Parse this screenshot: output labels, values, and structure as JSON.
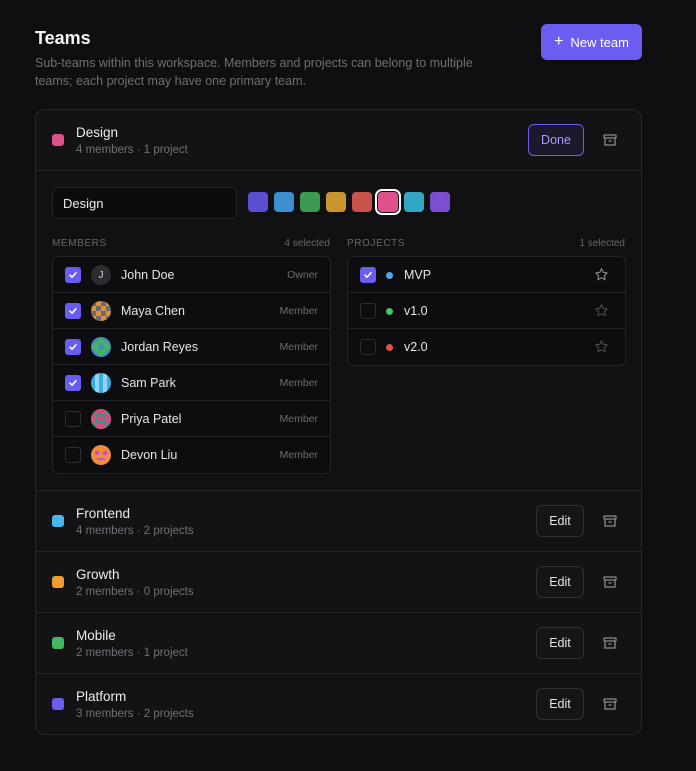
{
  "header": {
    "title": "Teams",
    "subtitle": "Sub-teams within this workspace. Members and projects can belong to multiple teams; each project may have one primary team.",
    "new_team_label": "New team"
  },
  "editing_team": {
    "name": "Design",
    "meta": "4 members · 1 project",
    "color": "#e0508c",
    "done_label": "Done",
    "name_input_value": "Design",
    "swatches": [
      "#5b4fd1",
      "#3d8fcf",
      "#3b9a4f",
      "#c8952f",
      "#c9524c",
      "#e0508c",
      "#33a7c2",
      "#7c4fd1"
    ],
    "selected_swatch": 5,
    "members_label": "MEMBERS",
    "members_count": "4 selected",
    "projects_label": "PROJECTS",
    "projects_count": "1 selected",
    "members": [
      {
        "name": "John Doe",
        "role": "Owner",
        "checked": true,
        "initial": "J"
      },
      {
        "name": "Maya Chen",
        "role": "Member",
        "checked": true
      },
      {
        "name": "Jordan Reyes",
        "role": "Member",
        "checked": true
      },
      {
        "name": "Sam Park",
        "role": "Member",
        "checked": true
      },
      {
        "name": "Priya Patel",
        "role": "Member",
        "checked": false
      },
      {
        "name": "Devon Liu",
        "role": "Member",
        "checked": false
      }
    ],
    "projects": [
      {
        "name": "MVP",
        "color": "#4aa8f0",
        "checked": true
      },
      {
        "name": "v1.0",
        "color": "#4cc06a",
        "checked": false
      },
      {
        "name": "v2.0",
        "color": "#e0514b",
        "checked": false
      }
    ]
  },
  "teams": [
    {
      "name": "Frontend",
      "meta": "4 members · 2 projects",
      "color": "#4ab6f0",
      "edit_label": "Edit"
    },
    {
      "name": "Growth",
      "meta": "2 members · 0 projects",
      "color": "#f09a32",
      "edit_label": "Edit"
    },
    {
      "name": "Mobile",
      "meta": "2 members · 1 project",
      "color": "#43b85e",
      "edit_label": "Edit"
    },
    {
      "name": "Platform",
      "meta": "3 members · 2 projects",
      "color": "#6b5cf2",
      "edit_label": "Edit"
    }
  ]
}
